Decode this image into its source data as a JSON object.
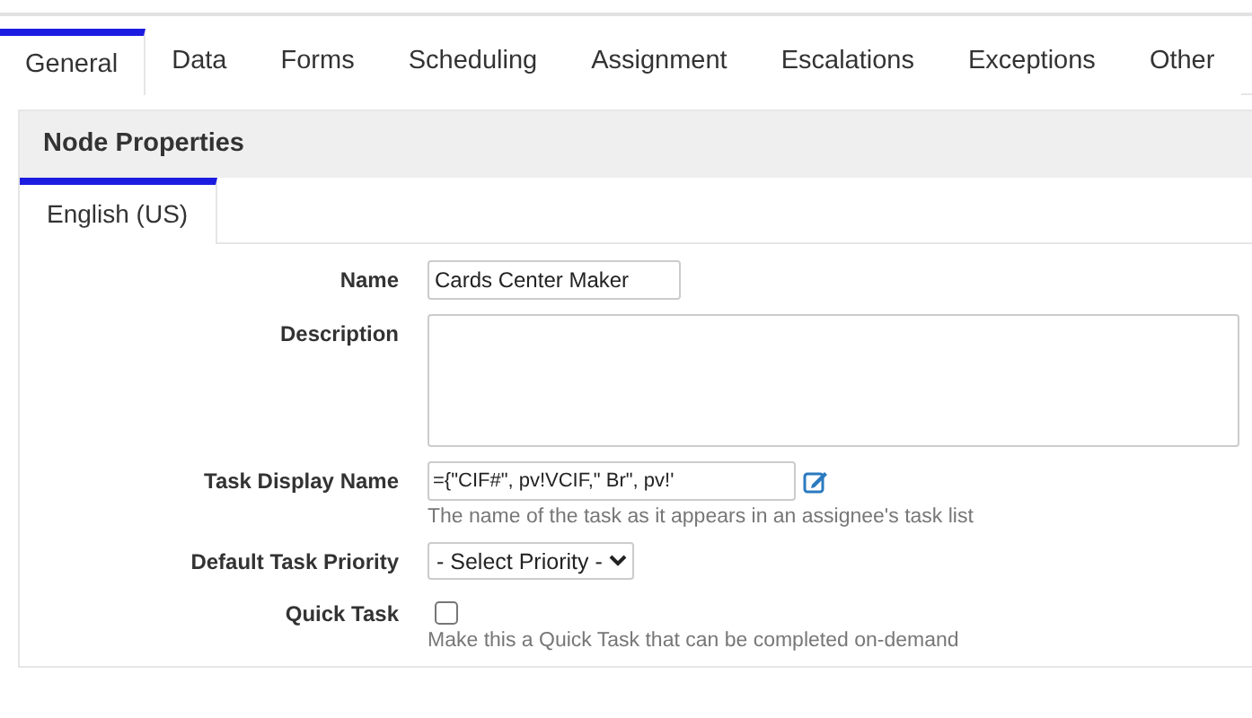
{
  "tabs": [
    {
      "label": "General",
      "selected": true
    },
    {
      "label": "Data",
      "selected": false
    },
    {
      "label": "Forms",
      "selected": false
    },
    {
      "label": "Scheduling",
      "selected": false
    },
    {
      "label": "Assignment",
      "selected": false
    },
    {
      "label": "Escalations",
      "selected": false
    },
    {
      "label": "Exceptions",
      "selected": false
    },
    {
      "label": "Other",
      "selected": false
    }
  ],
  "panel": {
    "title": "Node Properties",
    "language_tabs": [
      {
        "label": "English (US)",
        "selected": true
      }
    ],
    "fields": [
      {
        "kind": "text",
        "label": "Name",
        "value": "Cards Center Maker"
      },
      {
        "kind": "textarea",
        "label": "Description"
      },
      {
        "kind": "expression",
        "label": "Task Display Name",
        "value": "={\"CIF#\", pv!VCIF,\" Br\", pv!'",
        "hint": "The name of the task as it appears in an assignee's task list"
      },
      {
        "kind": "select",
        "label": "Default Task Priority",
        "value": "- Select Priority -"
      },
      {
        "kind": "checkbox",
        "label": "Quick Task",
        "checked": false,
        "hint": "Make this a Quick Task that can be completed on-demand"
      }
    ]
  }
}
